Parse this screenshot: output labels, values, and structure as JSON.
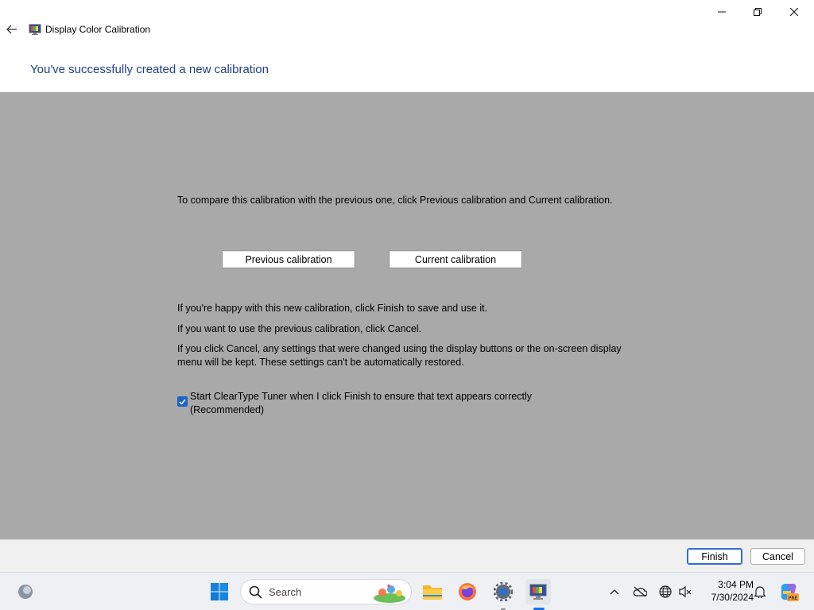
{
  "window": {
    "title": "Display Color Calibration",
    "controls": {
      "minimize": "minimize-icon",
      "maximize": "restore-icon",
      "close": "close-icon"
    }
  },
  "header": {
    "title": "You've successfully created a new calibration"
  },
  "content": {
    "compare_text": "To compare this calibration with the previous one, click Previous calibration and Current calibration.",
    "previous_button": "Previous calibration",
    "current_button": "Current calibration",
    "happy_text": "If you're happy with this new calibration, click Finish to save and use it.",
    "previous_text": "If you want to use the previous calibration, click Cancel.",
    "cancel_text": "If you click Cancel, any settings that were changed using the display buttons or the on-screen display menu will be kept. These settings can't be automatically restored.",
    "cleartype_checkbox": {
      "label": "Start ClearType Tuner when I click Finish to ensure that text appears correctly (Recommended)",
      "checked": true
    }
  },
  "footer": {
    "finish_label": "Finish",
    "cancel_label": "Cancel"
  },
  "taskbar": {
    "search_placeholder": "Search",
    "time": "3:04 PM",
    "date": "7/30/2024",
    "pinned": [
      "windows-start-icon",
      "search-icon",
      "file-explorer-icon",
      "firefox-icon",
      "settings-icon",
      "display-calibration-icon"
    ],
    "tray": [
      "chevron-up-icon",
      "onedrive-offline-icon",
      "network-globe-icon",
      "volume-muted-icon",
      "notification-bell-icon",
      "copilot-pre-icon"
    ]
  },
  "colors": {
    "header_title": "#1f3f86",
    "main_background": "#a9a9a9",
    "accent": "#1f63c6"
  }
}
